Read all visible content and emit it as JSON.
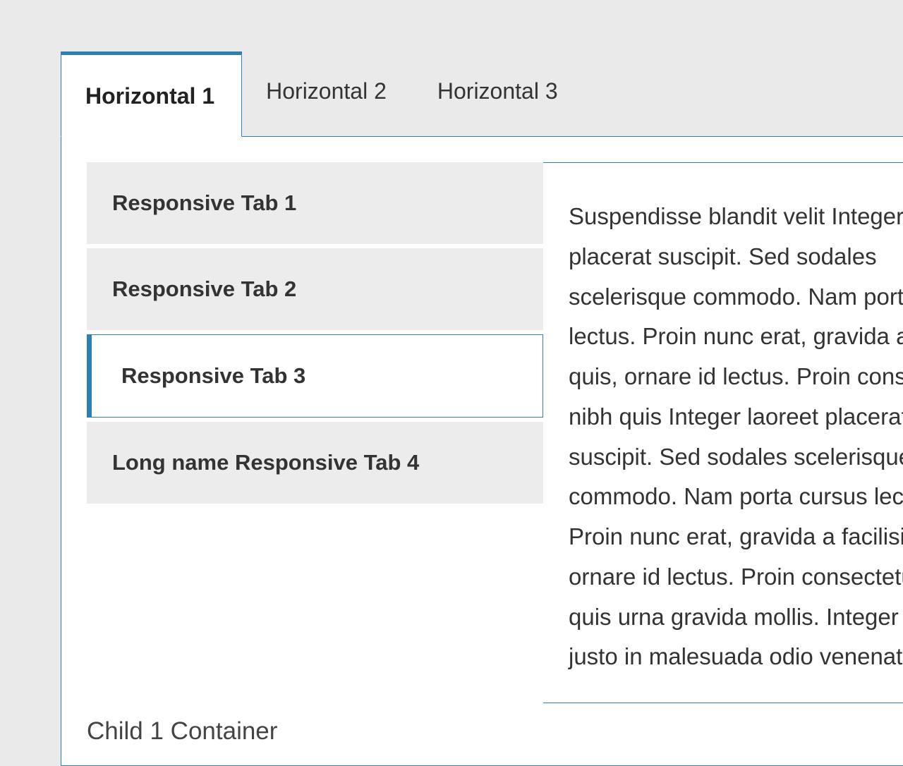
{
  "horizontal_tabs": {
    "tab1": {
      "label": "Horizontal 1",
      "active": true
    },
    "tab2": {
      "label": "Horizontal 2",
      "active": false
    },
    "tab3": {
      "label": "Horizontal 3",
      "active": false
    }
  },
  "vertical_tabs": {
    "tab1": {
      "label": "Responsive Tab 1",
      "active": false
    },
    "tab2": {
      "label": "Responsive Tab 2",
      "active": false
    },
    "tab3": {
      "label": "Responsive Tab 3",
      "active": true
    },
    "tab4": {
      "label": "Long name Responsive Tab 4",
      "active": false
    }
  },
  "tab_content": "Suspendisse blandit velit Integer laoreet placerat suscipit. Sed sodales scelerisque commodo. Nam porta cursus lectus. Proin nunc erat, gravida a facilisis quis, ornare id lectus. Proin consectetur nibh quis Integer laoreet placerat suscipit. Sed sodales scelerisque commodo. Nam porta cursus lectus. Proin nunc erat, gravida a facilisis quis, ornare id lectus. Proin consectetur nibh quis urna gravida mollis. Integer placerat justo in malesuada odio venenatis.",
  "child_label": "Child 1 Container"
}
